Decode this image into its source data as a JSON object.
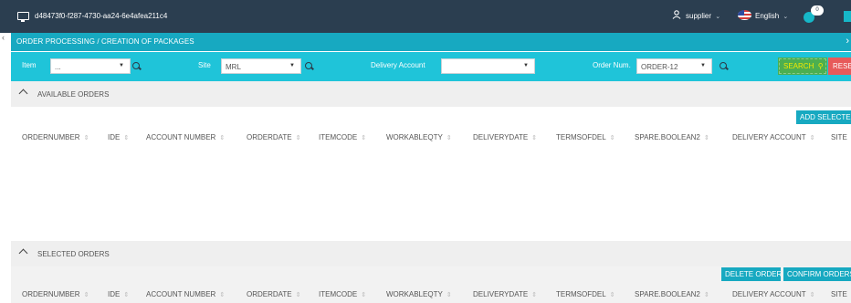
{
  "topbar": {
    "session_id": "d48473f0-f287-4730-aa24-6e4afea211c4",
    "user": "supplier",
    "language": "English",
    "notification_count": "0",
    "icons": [
      "monitor-icon",
      "user-icon",
      "flag-icon",
      "bell-icon"
    ]
  },
  "titlebar": {
    "title": "ORDER PROCESSING / CREATION OF PACKAGES",
    "close": "›"
  },
  "filters": {
    "item_label": "Item",
    "item_value": "...",
    "site_label": "Site",
    "site_value": "MRL",
    "delivery_label": "Delivery Account",
    "delivery_value": "",
    "order_label": "Order Num.",
    "order_value": "ORDER-12",
    "search_label": "SEARCH",
    "reset_label": "RESET"
  },
  "available": {
    "title": "AVAILABLE ORDERS",
    "add_selected": "ADD SELECTED"
  },
  "selected": {
    "title": "SELECTED ORDERS",
    "delete_order": "DELETE ORDER",
    "confirm_orders": "CONFIRM ORDERS"
  },
  "columns": [
    "ORDERNUMBER",
    "IDE",
    "ACCOUNT NUMBER",
    "ORDERDATE",
    "ITEMCODE",
    "WORKABLEQTY",
    "DELIVERYDATE",
    "TERMSOFDEL",
    "SPARE.BOOLEAN2",
    "DELIVERY ACCOUNT",
    "SITE"
  ],
  "colors": {
    "topbar": "#2b3e50",
    "titlebar": "#17a9c1",
    "filterbar": "#1fc4d9",
    "search": "#4caf50",
    "reset": "#e75a5a"
  }
}
